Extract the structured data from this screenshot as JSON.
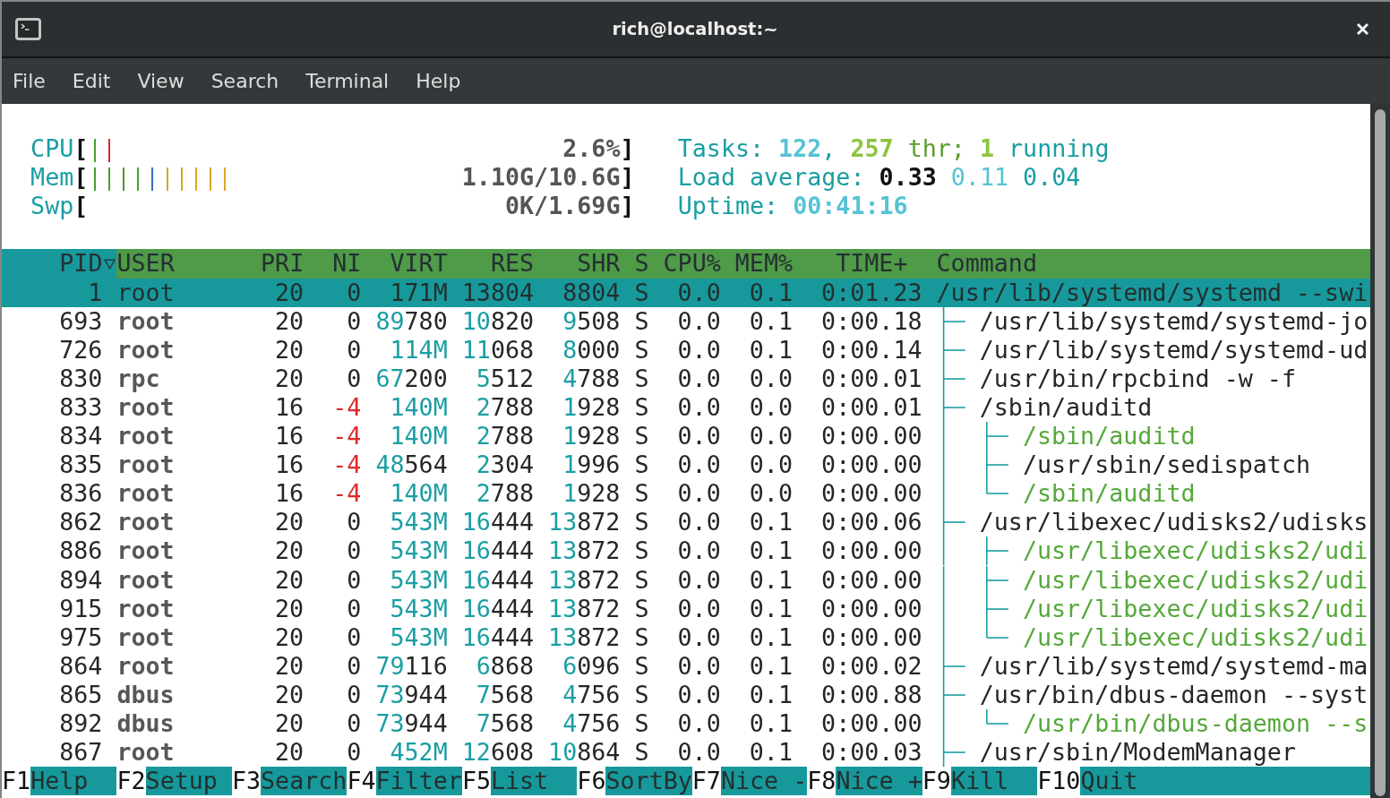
{
  "window": {
    "title": "rich@localhost:~"
  },
  "menu": [
    "File",
    "Edit",
    "View",
    "Search",
    "Terminal",
    "Help"
  ],
  "meters": [
    {
      "label": "CPU",
      "open": "[",
      "close": "]",
      "value": "2.6%",
      "bars": [
        {
          "color": "#45a02c"
        },
        {
          "color": "#d9262b"
        }
      ]
    },
    {
      "label": "Mem",
      "open": "[",
      "close": "]",
      "value": "1.10G/10.6G",
      "bars": [
        {
          "color": "#45a02c"
        },
        {
          "color": "#45a02c"
        },
        {
          "color": "#45a02c"
        },
        {
          "color": "#45a02c"
        },
        {
          "color": "#3a6fc0"
        },
        {
          "color": "#dba625"
        },
        {
          "color": "#dba625"
        },
        {
          "color": "#dba625"
        },
        {
          "color": "#dba625"
        },
        {
          "color": "#dba625"
        }
      ]
    },
    {
      "label": "Swp",
      "open": "[",
      "close": "]",
      "value": "0K/1.69G"
    }
  ],
  "summary": [
    {
      "parts": [
        {
          "kind": "label",
          "text": "Tasks:"
        },
        {
          "kind": "value",
          "text": "122"
        },
        {
          "kind": "separator",
          "text": ","
        },
        {
          "kind": "accent_value",
          "text": "257"
        },
        {
          "kind": "accent_label",
          "text": "thr;"
        },
        {
          "kind": "accent_value",
          "text": "1"
        },
        {
          "kind": "label",
          "text": "running"
        }
      ]
    },
    {
      "parts": [
        {
          "kind": "label",
          "text": "Load average:"
        },
        {
          "kind": "load_1",
          "text": "0.33"
        },
        {
          "kind": "load_5",
          "text": "0.11"
        },
        {
          "kind": "load_15",
          "text": "0.04"
        }
      ]
    },
    {
      "parts": [
        {
          "kind": "label",
          "text": "Uptime:"
        },
        {
          "kind": "value",
          "text": "00:41:16"
        }
      ]
    }
  ],
  "columns": [
    {
      "label": "PID",
      "sorted": true
    },
    {
      "label": "USER",
      "sorted": false
    },
    {
      "label": "PRI",
      "sorted": false
    },
    {
      "label": "NI",
      "sorted": false
    },
    {
      "label": "VIRT",
      "sorted": false
    },
    {
      "label": "RES",
      "sorted": false
    },
    {
      "label": "SHR",
      "sorted": false
    },
    {
      "label": "S",
      "sorted": false
    },
    {
      "label": "CPU%",
      "sorted": false
    },
    {
      "label": "MEM%",
      "sorted": false
    },
    {
      "label": "TIME+",
      "sorted": false
    },
    {
      "label": "Command",
      "sorted": false
    }
  ],
  "processes": [
    {
      "pid": "1",
      "user": "root",
      "priority": "20",
      "nice": "0",
      "virt": "171M",
      "res": "13804",
      "shr": "8804",
      "state": "S",
      "cpu": "0.0",
      "mem": "0.1",
      "time": "0:01.23",
      "command": "/usr/lib/systemd/systemd --swi",
      "selected": true,
      "more_children_below": true,
      "children": [
        {
          "pid": "693",
          "user": "root",
          "priority": "20",
          "nice": "0",
          "virt": "89780",
          "res": "10820",
          "shr": "9508",
          "state": "S",
          "cpu": "0.0",
          "mem": "0.1",
          "time": "0:00.18",
          "command": "/usr/lib/systemd/systemd-jo",
          "selected": false,
          "thread": false
        },
        {
          "pid": "726",
          "user": "root",
          "priority": "20",
          "nice": "0",
          "virt": "114M",
          "res": "11068",
          "shr": "8000",
          "state": "S",
          "cpu": "0.0",
          "mem": "0.1",
          "time": "0:00.14",
          "command": "/usr/lib/systemd/systemd-ud",
          "selected": false,
          "thread": false
        },
        {
          "pid": "830",
          "user": "rpc",
          "priority": "20",
          "nice": "0",
          "virt": "67200",
          "res": "5512",
          "shr": "4788",
          "state": "S",
          "cpu": "0.0",
          "mem": "0.0",
          "time": "0:00.01",
          "command": "/usr/bin/rpcbind -w -f",
          "selected": false,
          "thread": false
        },
        {
          "pid": "833",
          "user": "root",
          "priority": "16",
          "nice": "-4",
          "virt": "140M",
          "res": "2788",
          "shr": "1928",
          "state": "S",
          "cpu": "0.0",
          "mem": "0.0",
          "time": "0:00.01",
          "command": "/sbin/auditd",
          "selected": false,
          "thread": false,
          "more_children_below": false,
          "children": [
            {
              "pid": "834",
              "user": "root",
              "priority": "16",
              "nice": "-4",
              "virt": "140M",
              "res": "2788",
              "shr": "1928",
              "state": "S",
              "cpu": "0.0",
              "mem": "0.0",
              "time": "0:00.00",
              "command": "/sbin/auditd",
              "selected": false,
              "thread": true
            },
            {
              "pid": "835",
              "user": "root",
              "priority": "16",
              "nice": "-4",
              "virt": "48564",
              "res": "2304",
              "shr": "1996",
              "state": "S",
              "cpu": "0.0",
              "mem": "0.0",
              "time": "0:00.00",
              "command": "/usr/sbin/sedispatch",
              "selected": false,
              "thread": false
            },
            {
              "pid": "836",
              "user": "root",
              "priority": "16",
              "nice": "-4",
              "virt": "140M",
              "res": "2788",
              "shr": "1928",
              "state": "S",
              "cpu": "0.0",
              "mem": "0.0",
              "time": "0:00.00",
              "command": "/sbin/auditd",
              "selected": false,
              "thread": true
            }
          ]
        },
        {
          "pid": "862",
          "user": "root",
          "priority": "20",
          "nice": "0",
          "virt": "543M",
          "res": "16444",
          "shr": "13872",
          "state": "S",
          "cpu": "0.0",
          "mem": "0.1",
          "time": "0:00.06",
          "command": "/usr/libexec/udisks2/udisks",
          "selected": false,
          "thread": false,
          "more_children_below": false,
          "children": [
            {
              "pid": "886",
              "user": "root",
              "priority": "20",
              "nice": "0",
              "virt": "543M",
              "res": "16444",
              "shr": "13872",
              "state": "S",
              "cpu": "0.0",
              "mem": "0.1",
              "time": "0:00.00",
              "command": "/usr/libexec/udisks2/udi",
              "selected": false,
              "thread": true
            },
            {
              "pid": "894",
              "user": "root",
              "priority": "20",
              "nice": "0",
              "virt": "543M",
              "res": "16444",
              "shr": "13872",
              "state": "S",
              "cpu": "0.0",
              "mem": "0.1",
              "time": "0:00.00",
              "command": "/usr/libexec/udisks2/udi",
              "selected": false,
              "thread": true
            },
            {
              "pid": "915",
              "user": "root",
              "priority": "20",
              "nice": "0",
              "virt": "543M",
              "res": "16444",
              "shr": "13872",
              "state": "S",
              "cpu": "0.0",
              "mem": "0.1",
              "time": "0:00.00",
              "command": "/usr/libexec/udisks2/udi",
              "selected": false,
              "thread": true
            },
            {
              "pid": "975",
              "user": "root",
              "priority": "20",
              "nice": "0",
              "virt": "543M",
              "res": "16444",
              "shr": "13872",
              "state": "S",
              "cpu": "0.0",
              "mem": "0.1",
              "time": "0:00.00",
              "command": "/usr/libexec/udisks2/udi",
              "selected": false,
              "thread": true
            }
          ]
        },
        {
          "pid": "864",
          "user": "root",
          "priority": "20",
          "nice": "0",
          "virt": "79116",
          "res": "6868",
          "shr": "6096",
          "state": "S",
          "cpu": "0.0",
          "mem": "0.1",
          "time": "0:00.02",
          "command": "/usr/lib/systemd/systemd-ma",
          "selected": false,
          "thread": false
        },
        {
          "pid": "865",
          "user": "dbus",
          "priority": "20",
          "nice": "0",
          "virt": "73944",
          "res": "7568",
          "shr": "4756",
          "state": "S",
          "cpu": "0.0",
          "mem": "0.1",
          "time": "0:00.88",
          "command": "/usr/bin/dbus-daemon --syst",
          "selected": false,
          "thread": false,
          "more_children_below": false,
          "children": [
            {
              "pid": "892",
              "user": "dbus",
              "priority": "20",
              "nice": "0",
              "virt": "73944",
              "res": "7568",
              "shr": "4756",
              "state": "S",
              "cpu": "0.0",
              "mem": "0.1",
              "time": "0:00.00",
              "command": "/usr/bin/dbus-daemon --s",
              "selected": false,
              "thread": true
            }
          ]
        },
        {
          "pid": "867",
          "user": "root",
          "priority": "20",
          "nice": "0",
          "virt": "452M",
          "res": "12608",
          "shr": "10864",
          "state": "S",
          "cpu": "0.0",
          "mem": "0.1",
          "time": "0:00.03",
          "command": "/usr/sbin/ModemManager",
          "selected": false,
          "thread": false
        }
      ]
    }
  ],
  "function_keys": [
    {
      "key": "F1",
      "label": "Help"
    },
    {
      "key": "F2",
      "label": "Setup"
    },
    {
      "key": "F3",
      "label": "Search"
    },
    {
      "key": "F4",
      "label": "Filter"
    },
    {
      "key": "F5",
      "label": "List"
    },
    {
      "key": "F6",
      "label": "SortBy"
    },
    {
      "key": "F7",
      "label": "Nice -"
    },
    {
      "key": "F8",
      "label": "Nice +"
    },
    {
      "key": "F9",
      "label": "Kill"
    },
    {
      "key": "F10",
      "label": "Quit"
    }
  ]
}
